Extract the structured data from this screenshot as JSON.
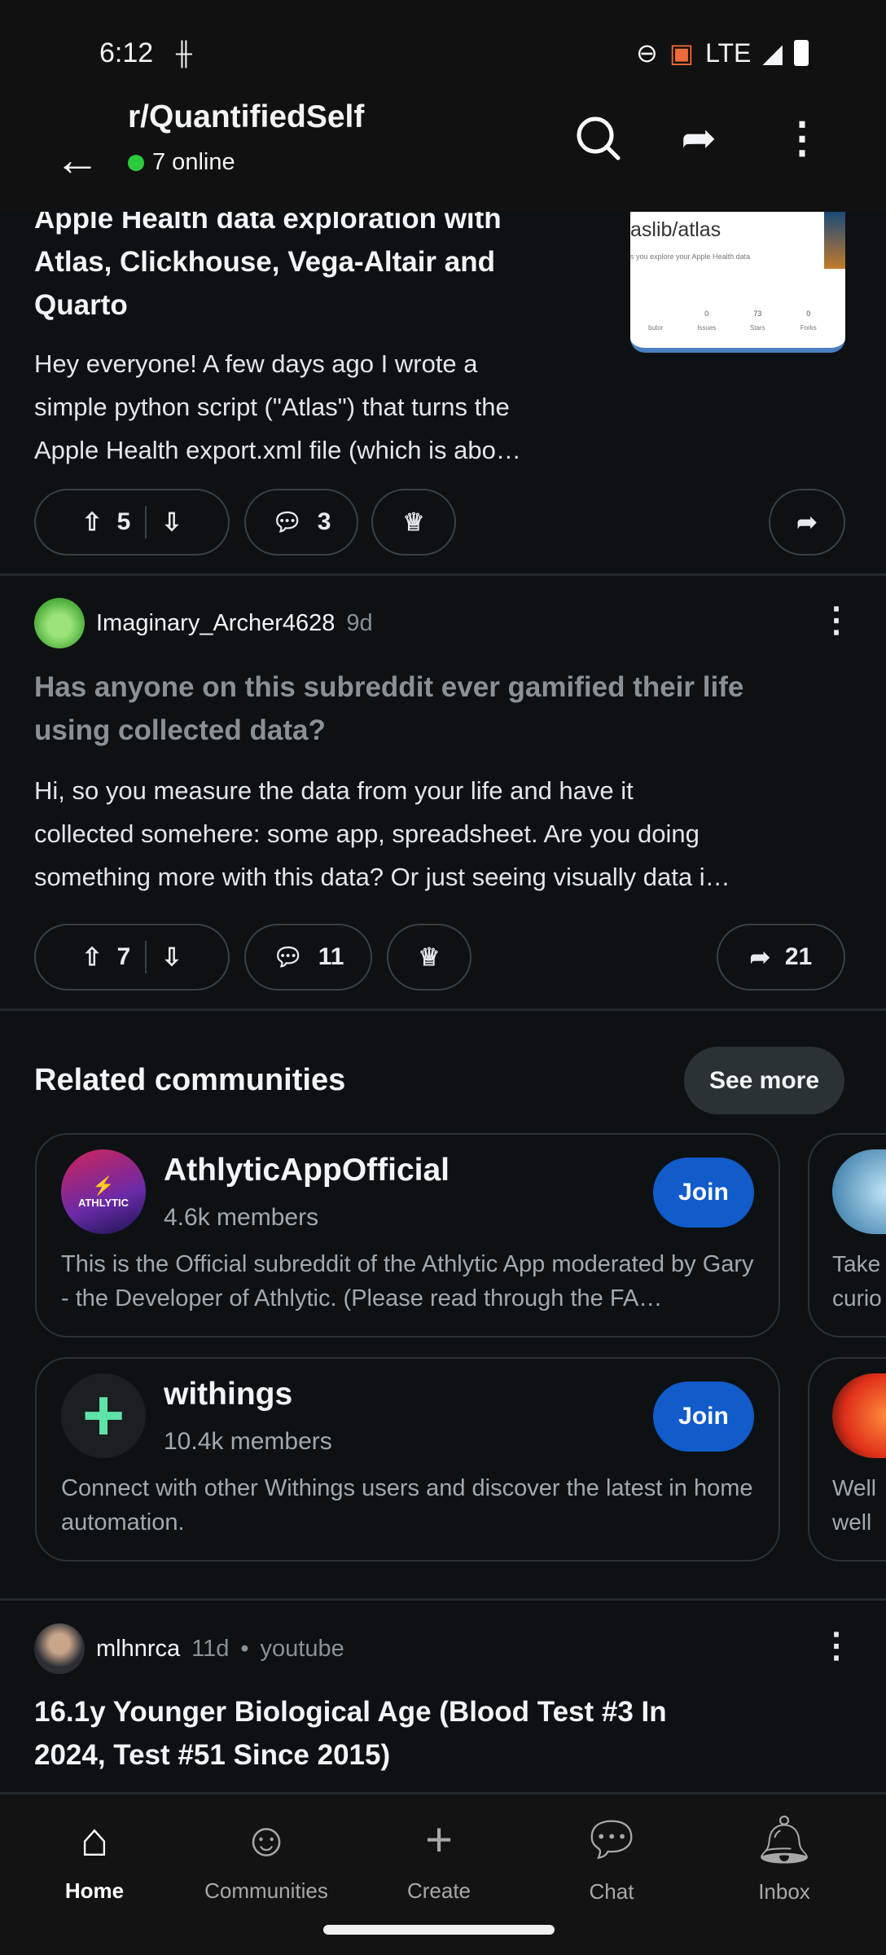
{
  "status": {
    "time": "6:12",
    "network": "LTE"
  },
  "header": {
    "title": "r/QuantifiedSelf",
    "online": "7 online"
  },
  "posts": [
    {
      "title_lines": [
        "Apple Health data exploration with",
        "Atlas, Clickhouse, Vega-Altair and",
        "Quarto"
      ],
      "body": [
        "Hey everyone! A few days ago I wrote a",
        "simple python script (\"Atlas\") that turns the",
        "Apple Health export.xml file (which is abo…"
      ],
      "votes": "5",
      "comments": "3",
      "thumb": {
        "repo": "aslib/atlas",
        "desc": "s you explore your Apple Health data",
        "stats": [
          "0",
          "73",
          "0"
        ],
        "stat_labels": [
          "butor",
          "Issues",
          "Stars",
          "Forks"
        ]
      }
    },
    {
      "author": "Imaginary_Archer4628",
      "age": "9d",
      "title_lines": [
        "Has anyone on this subreddit ever gamified their life",
        "using collected data?"
      ],
      "body": [
        "Hi, so you measure the data from your life and have it",
        "collected somehere: some app, spreadsheet. Are you doing",
        "something more with this data? Or just seeing visually data i…"
      ],
      "votes": "7",
      "comments": "11",
      "shares": "21"
    },
    {
      "author": "mlhnrca",
      "age": "11d",
      "source": "youtube",
      "title_lines": [
        "16.1y Younger Biological Age (Blood Test #3 In",
        "2024, Test #51 Since 2015)"
      ]
    }
  ],
  "related": {
    "title": "Related communities",
    "see_more": "See more",
    "communities": [
      {
        "name": "AthlyticAppOfficial",
        "members": "4.6k members",
        "desc": "This is the Official subreddit of the Athlytic App moderated by Gary - the Developer of Athlytic.  (Please read through the FA…",
        "logo_text": "ATHLYTIC",
        "join": "Join"
      },
      {
        "name": "withings",
        "members": "10.4k members",
        "desc": "Connect with other Withings users and discover the latest in home automation.",
        "join": "Join"
      }
    ],
    "peek": [
      [
        "Take",
        "curio"
      ],
      [
        "Well",
        "well"
      ]
    ]
  },
  "nav": [
    {
      "label": "Home",
      "icon": "home-icon",
      "active": true
    },
    {
      "label": "Communities",
      "icon": "communities-icon"
    },
    {
      "label": "Create",
      "icon": "plus-icon"
    },
    {
      "label": "Chat",
      "icon": "chat-icon"
    },
    {
      "label": "Inbox",
      "icon": "bell-icon"
    }
  ],
  "colors": {
    "background": "#0e1113",
    "join": "#115bca",
    "online": "#2bc93b"
  }
}
